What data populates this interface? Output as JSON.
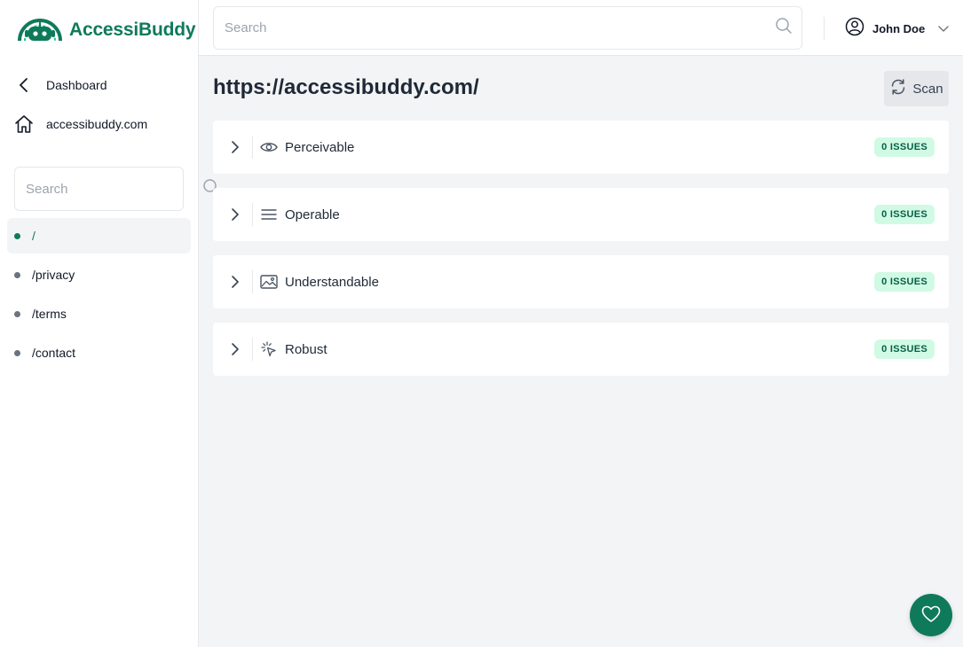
{
  "brand": {
    "name": "AccessiBuddy",
    "accent": "#0f7a5a"
  },
  "sidebar": {
    "back_link": {
      "label": "Dashboard",
      "icon": "chevron-left-icon"
    },
    "site_link": {
      "label": "accessibuddy.com",
      "icon": "home-icon"
    },
    "search": {
      "placeholder": "Search"
    },
    "pages": [
      {
        "label": "/",
        "active": true
      },
      {
        "label": "/privacy",
        "active": false
      },
      {
        "label": "/terms",
        "active": false
      },
      {
        "label": "/contact",
        "active": false
      }
    ]
  },
  "topbar": {
    "search": {
      "placeholder": "Search"
    },
    "user": {
      "name": "John Doe",
      "icon": "user-circle-icon"
    }
  },
  "main": {
    "url": "https://accessibuddy.com/",
    "scan_label": "Scan",
    "categories": [
      {
        "label": "Perceivable",
        "icon": "eye-icon",
        "badge": "0 ISSUES"
      },
      {
        "label": "Operable",
        "icon": "menu-lines-icon",
        "badge": "0 ISSUES"
      },
      {
        "label": "Understandable",
        "icon": "image-icon",
        "badge": "0 ISSUES"
      },
      {
        "label": "Robust",
        "icon": "cursor-click-icon",
        "badge": "0 ISSUES"
      }
    ]
  },
  "fab": {
    "icon": "heart-icon"
  },
  "colors": {
    "badge_bg": "#d1fae5",
    "badge_text": "#065f46",
    "background": "#f3f4f6"
  }
}
